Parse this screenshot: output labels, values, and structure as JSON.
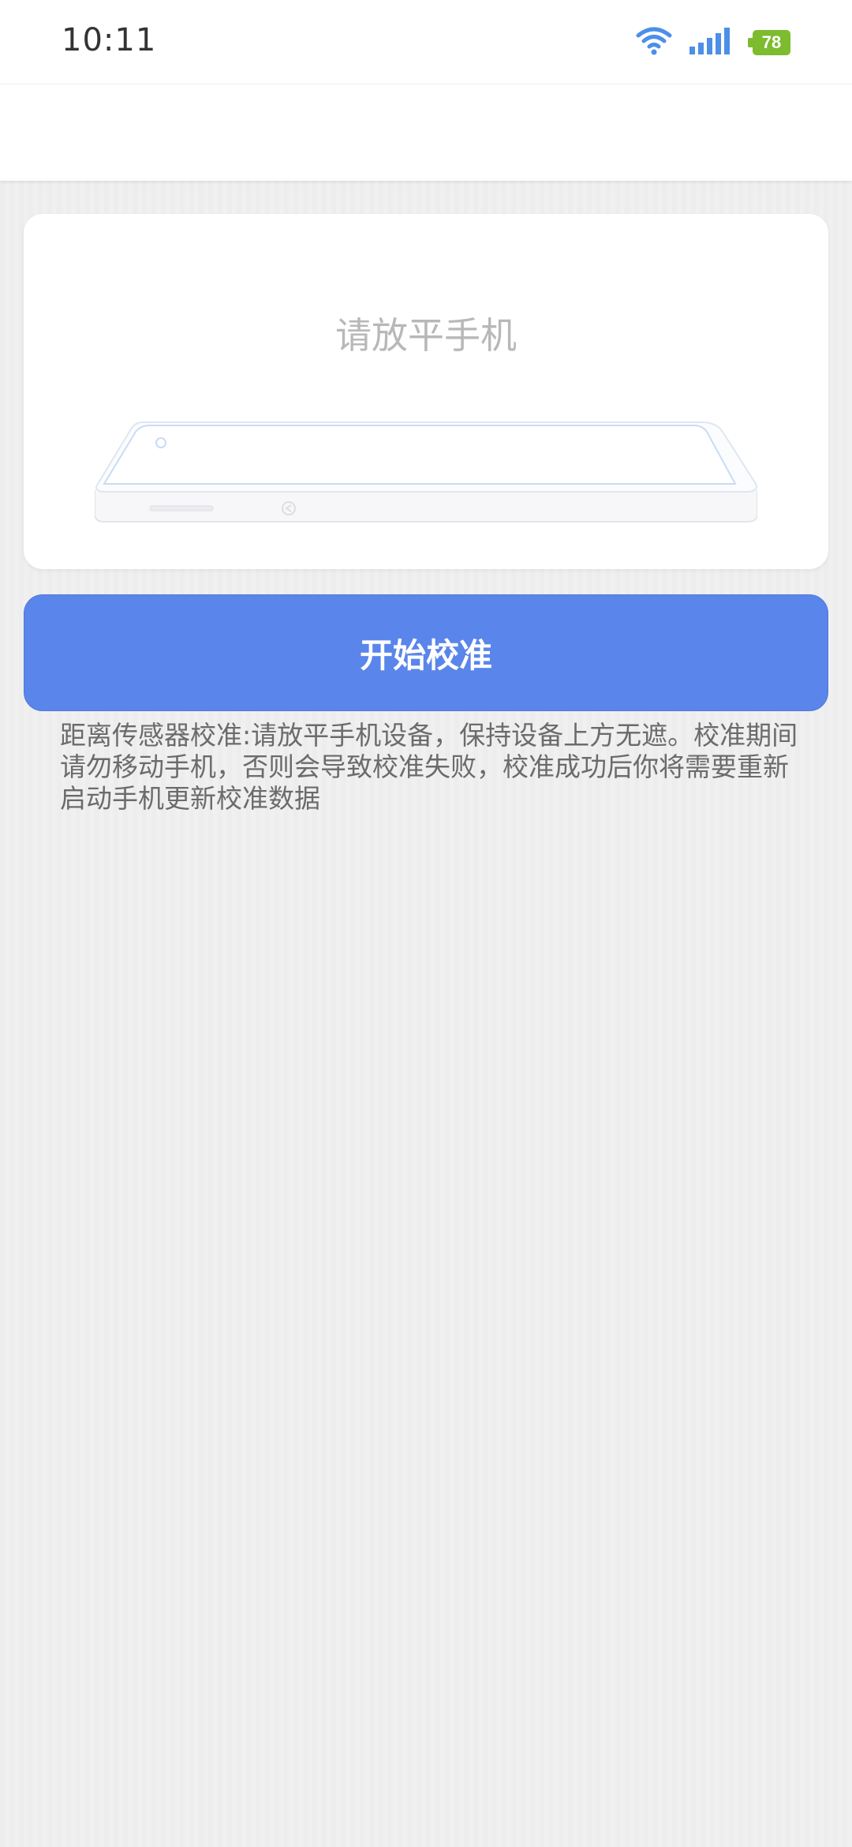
{
  "status_bar": {
    "time": "10:11",
    "battery_level": "78",
    "wifi_icon": "wifi-icon",
    "signal_icon": "signal-icon",
    "battery_color": "#7dbb2f",
    "network_icon_color": "#4c8fe8"
  },
  "card": {
    "title": "请放平手机",
    "illustration_icon": "flat-phone-illustration"
  },
  "start_button": {
    "label": "开始校准",
    "color": "#5a85ea"
  },
  "description": {
    "text": "距离传感器校准:请放平手机设备，保持设备上方无遮。校准期间请勿移动手机，否则会导致校准失败，校准成功后你将需要重新启动手机更新校准数据"
  }
}
